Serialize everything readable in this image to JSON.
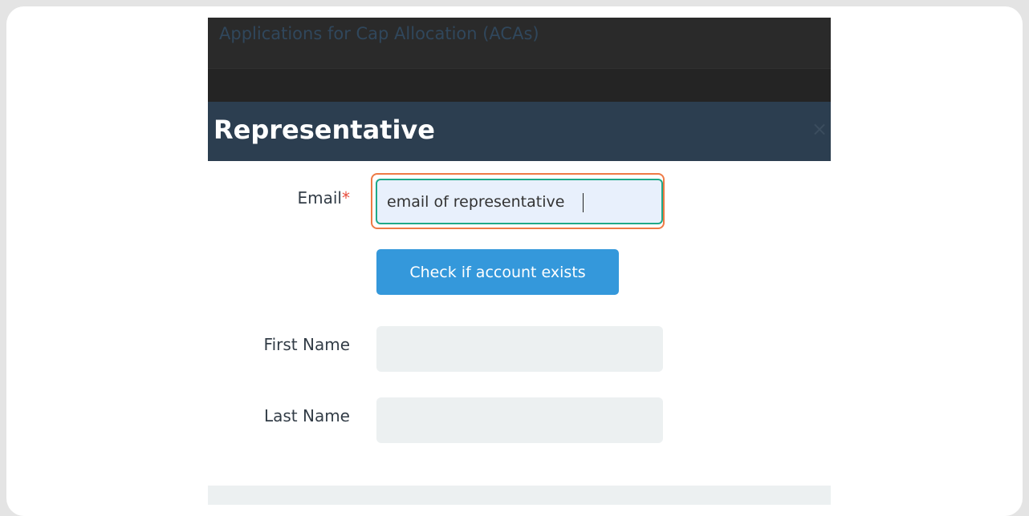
{
  "backdrop": {
    "title": "Applications for Cap Allocation (ACAs)"
  },
  "modal": {
    "title": "Representative",
    "close_glyph": "×"
  },
  "form": {
    "email": {
      "label": "Email",
      "required_mark": "*",
      "value": "email of representative"
    },
    "check_button_label": "Check if account exists",
    "first_name": {
      "label": "First Name",
      "value": ""
    },
    "last_name": {
      "label": "Last Name",
      "value": ""
    }
  },
  "colors": {
    "header_bg": "#2c3e50",
    "button_bg": "#3498db",
    "focus_ring": "#ee7a45",
    "input_border": "#1fa989",
    "required": "#e74c3c"
  }
}
